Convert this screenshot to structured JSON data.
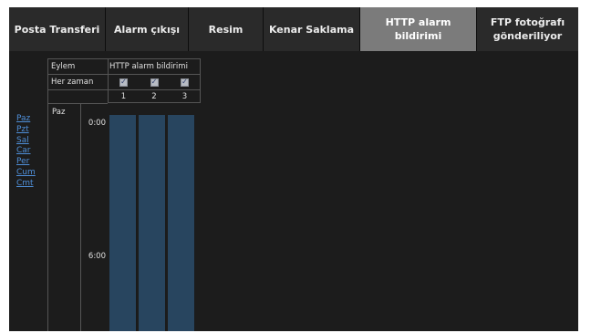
{
  "tabs": [
    {
      "label": "Posta Transferi",
      "active": false
    },
    {
      "label": "Alarm çıkışı",
      "active": false
    },
    {
      "label": "Resim",
      "active": false
    },
    {
      "label": "Kenar Saklama",
      "active": false
    },
    {
      "label": "HTTP alarm bildirimi",
      "active": true
    },
    {
      "label": "FTP fotoğrafı gönderiliyor",
      "active": false
    }
  ],
  "days": [
    "Paz",
    "Pzt",
    "Sal",
    "Car",
    "Per",
    "Cum",
    "Cmt"
  ],
  "schedule": {
    "action_label": "Eylem",
    "action_value": "HTTP alarm bildirimi",
    "always_label": "Her zaman",
    "always_checked": [
      true,
      true,
      true
    ],
    "columns": [
      "1",
      "2",
      "3"
    ],
    "day_label": "Paz",
    "times": [
      "0:00",
      "6:00"
    ]
  },
  "colors": {
    "active_tab": "#7b7b7b",
    "bar": "#28455f",
    "link": "#4f8fd8"
  }
}
